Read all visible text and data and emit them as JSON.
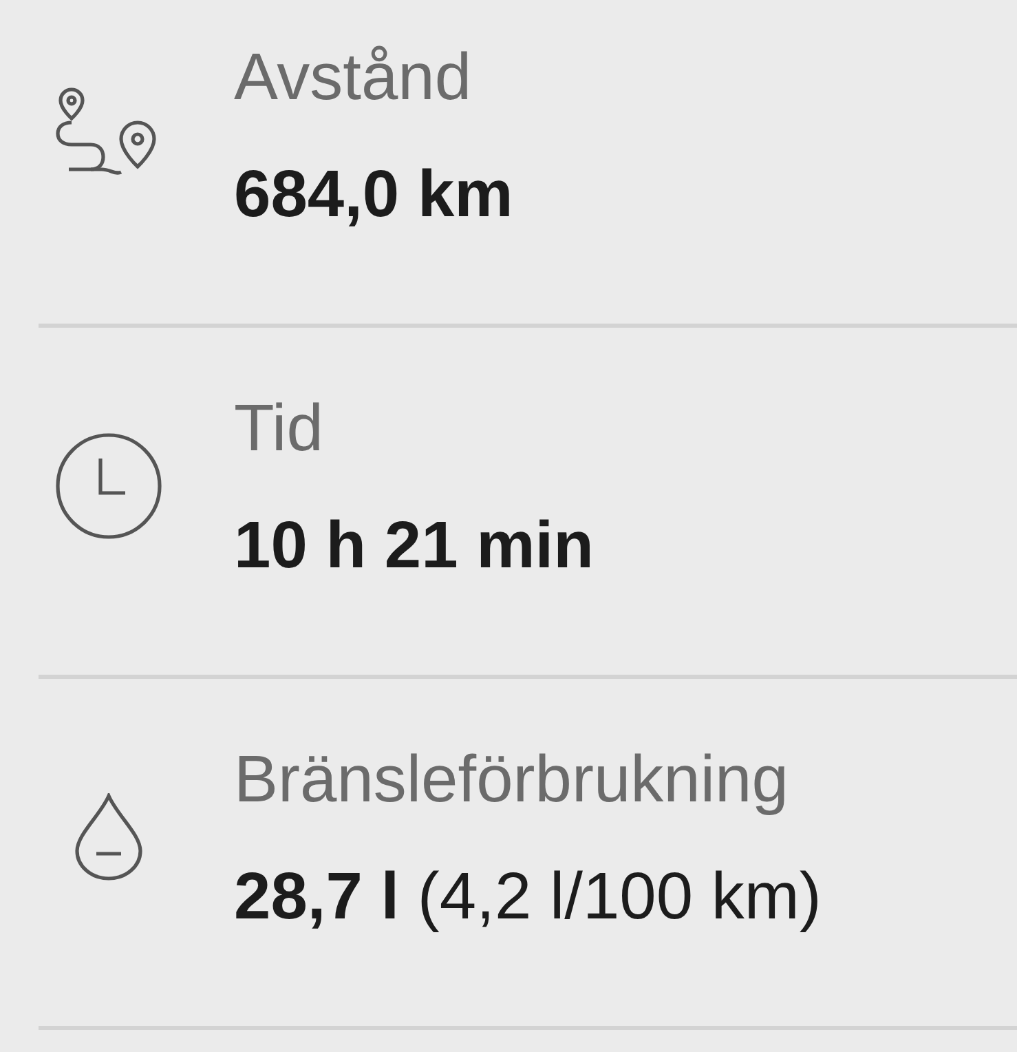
{
  "stats": [
    {
      "kind": "route",
      "label": "Avstånd",
      "value": "**684,0 km**"
    },
    {
      "kind": "clock",
      "label": "Tid",
      "value": "**10 h 21 min**"
    },
    {
      "kind": "drop",
      "label": "Bränsleförbrukning",
      "value": "**28,7 l** (4,2 l/100 km)"
    }
  ]
}
